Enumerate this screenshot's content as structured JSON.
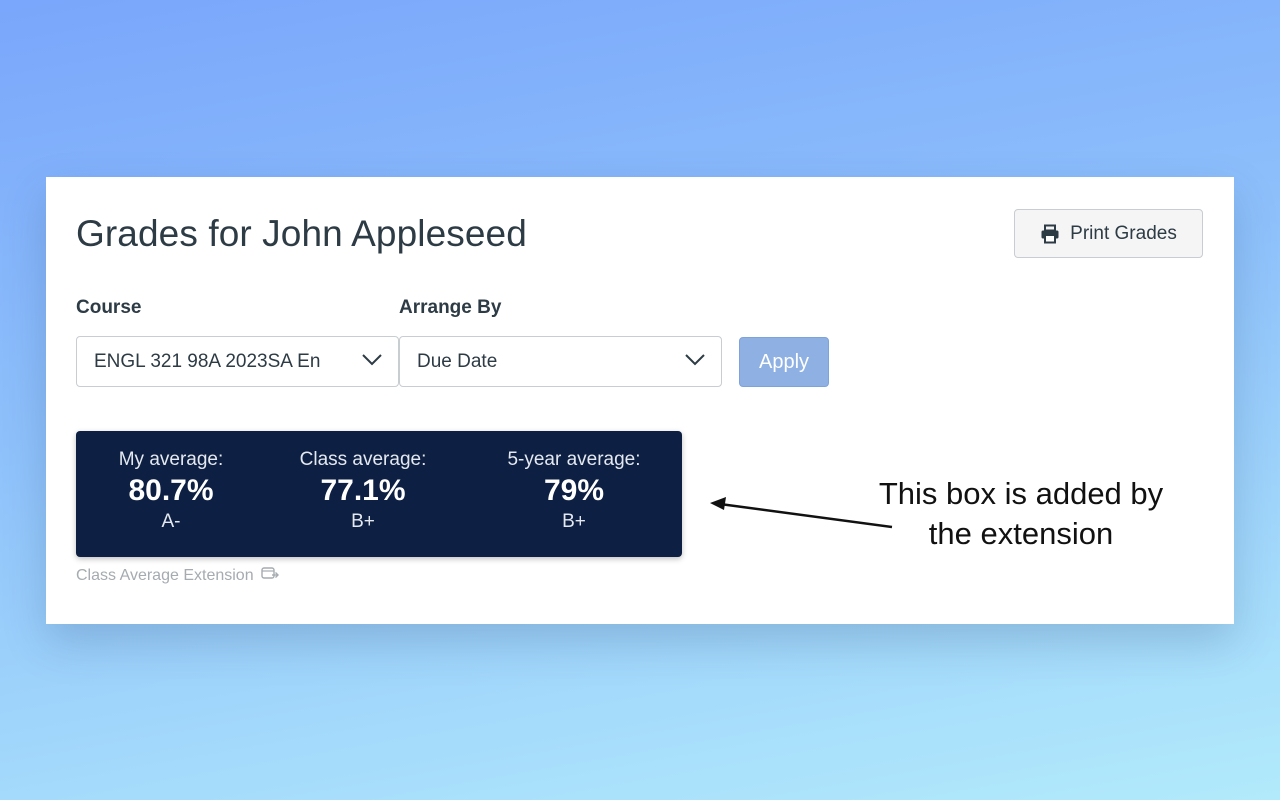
{
  "page": {
    "title": "Grades for John Appleseed",
    "print_button": {
      "label": "Print Grades",
      "icon": "printer-icon"
    }
  },
  "filters": {
    "course": {
      "label": "Course",
      "selected": "ENGL 321 98A 2023SA En"
    },
    "arrange_by": {
      "label": "Arrange By",
      "selected": "Due Date"
    },
    "apply_label": "Apply"
  },
  "averages": [
    {
      "label": "My average:",
      "value": "80.7%",
      "letter": "A-"
    },
    {
      "label": "Class average:",
      "value": "77.1%",
      "letter": "B+"
    },
    {
      "label": "5-year average:",
      "value": "79%",
      "letter": "B+"
    }
  ],
  "extension_credit": "Class Average Extension",
  "annotation": {
    "line1": "This box is added by",
    "line2": "the extension"
  },
  "colors": {
    "background_top": "#7aa6fb",
    "background_bottom": "#b2eafb",
    "averages_box": "#0d1f42",
    "apply_button": "#8fb0e3",
    "text": "#2d3b45"
  }
}
